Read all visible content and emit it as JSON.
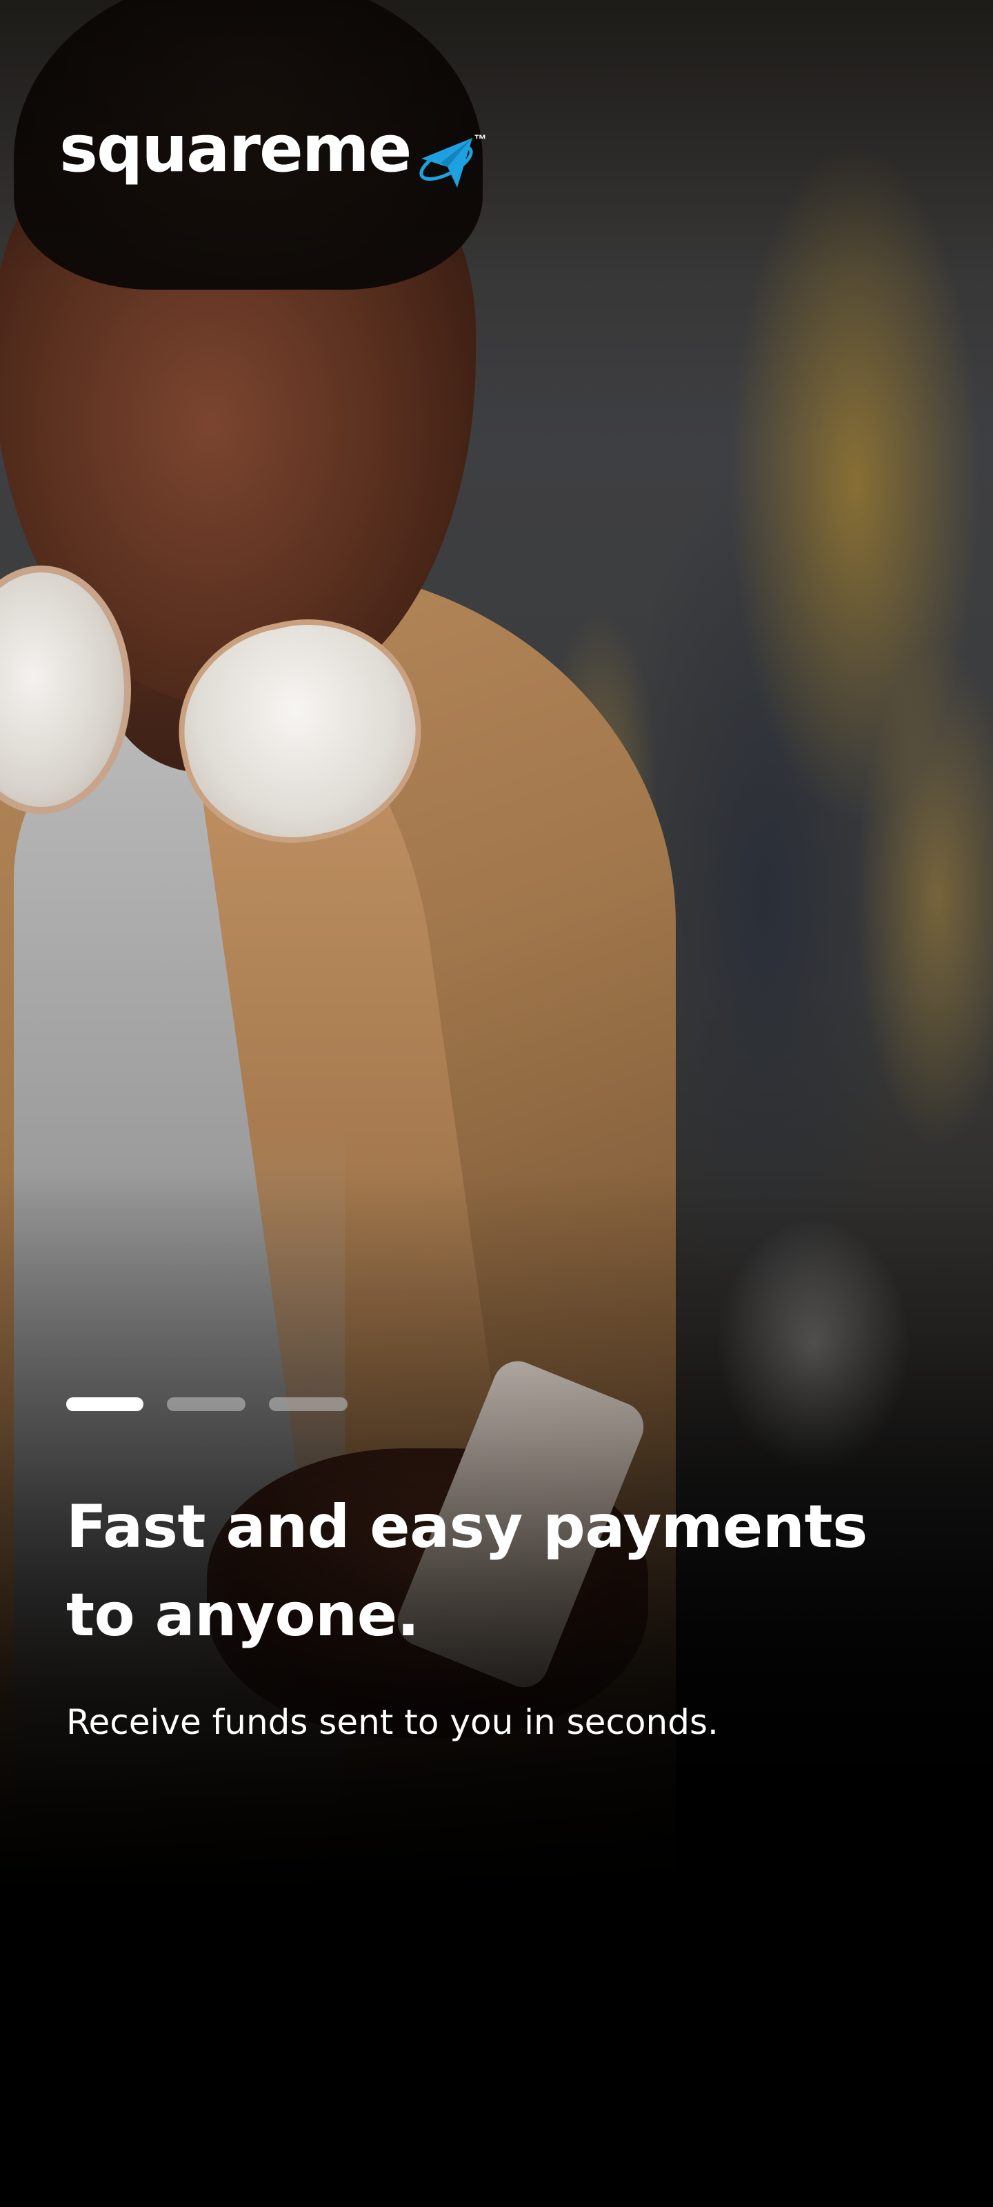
{
  "brand": {
    "name": "squareme",
    "trademark": "™",
    "logo_icon": "paper-plane-orbit-icon",
    "accent_color": "#1da1e0"
  },
  "onboarding": {
    "pages_total": 3,
    "active_page": 1,
    "headline": "Fast and easy payments to anyone.",
    "subtext": "Receive funds sent to you in seconds."
  },
  "colors": {
    "text": "#ffffff",
    "indicator_active": "#ffffff",
    "indicator_inactive": "#9a9a9a",
    "background_bottom": "#000000"
  }
}
